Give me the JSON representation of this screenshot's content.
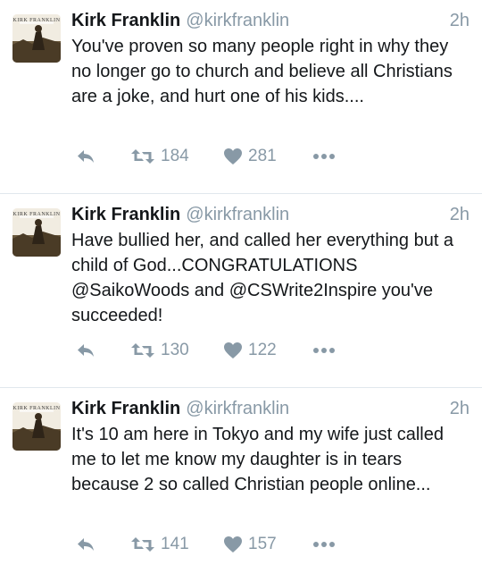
{
  "tweets": [
    {
      "author_name": "Kirk Franklin",
      "handle": "@kirkfranklin",
      "time": "2h",
      "text": "You've proven so many people right in why they no longer go to church and believe all Christians are a joke, and hurt one of his kids....",
      "retweets": "184",
      "likes": "281",
      "avatar_caption": "KIRK FRANKLIN"
    },
    {
      "author_name": "Kirk Franklin",
      "handle": "@kirkfranklin",
      "time": "2h",
      "text": "Have bullied her, and called her everything but a child of God...CONGRATULATIONS @SaikoWoods and @CSWrite2Inspire you've succeeded!",
      "retweets": "130",
      "likes": "122",
      "avatar_caption": "KIRK FRANKLIN"
    },
    {
      "author_name": "Kirk Franklin",
      "handle": "@kirkfranklin",
      "time": "2h",
      "text": "It's 10 am here in Tokyo and my wife just called me to let me know my daughter is in tears because 2 so called Christian people online...",
      "retweets": "141",
      "likes": "157",
      "avatar_caption": "KIRK FRANKLIN"
    }
  ],
  "icons": {
    "reply": "reply-icon",
    "retweet": "retweet-icon",
    "like": "heart-icon",
    "more": "more-icon"
  },
  "colors": {
    "text": "#14171a",
    "secondary": "#8899a6",
    "divider": "#e1e8ed"
  }
}
